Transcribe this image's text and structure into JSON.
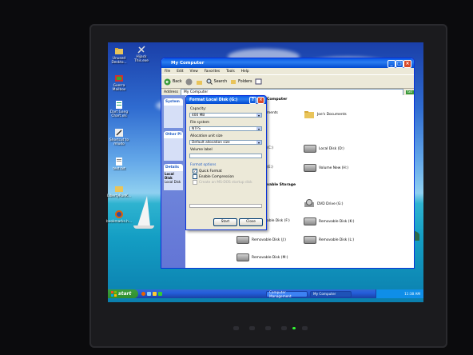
{
  "desktop": {
    "icons": [
      {
        "label": "Unused Deskto..."
      },
      {
        "label": "Hijack This.exe"
      },
      {
        "label": "Guerra Mailbox"
      },
      {
        "label": "Dart Gang Chart.xls"
      },
      {
        "label": "Shortcut to mludo"
      },
      {
        "label": "test.txt"
      },
      {
        "label": "LibertyRunK..."
      },
      {
        "label": "bookmarks.h..."
      }
    ]
  },
  "window": {
    "title": "My Computer",
    "menu": [
      "File",
      "Edit",
      "View",
      "Favorites",
      "Tools",
      "Help"
    ],
    "toolbar": {
      "back": "Back",
      "search": "Search",
      "folders": "Folders"
    },
    "address_label": "Address",
    "address_value": "My Computer",
    "go_label": "Go",
    "task_panels": [
      {
        "title": "System"
      },
      {
        "title": "Other Pl"
      },
      {
        "title": "Details"
      }
    ],
    "details": {
      "name": "Local Disk",
      "sub": "Local Disk"
    },
    "content": {
      "heading_files": "Computer",
      "heading_hdd": "",
      "heading_removable": "vable Storage",
      "shared_docs": "ments",
      "user_docs": "Joe's Documents",
      "drives": [
        {
          "label": "(C:)"
        },
        {
          "label": "Local Disk (D:)"
        },
        {
          "label": "(E:)"
        },
        {
          "label": "Volume New (H:)"
        }
      ],
      "removable": [
        {
          "label": "DVD Drive (G:)"
        },
        {
          "label": "able Disk (F:)"
        },
        {
          "label": "Removable Disk (K:)"
        },
        {
          "label": "Removable Disk (J:)"
        },
        {
          "label": "Removable Disk (L:)"
        },
        {
          "label": "Removable Disk (M:)"
        }
      ]
    }
  },
  "dialog": {
    "title": "Format Local Disk (G:)",
    "capacity_label": "Capacity:",
    "capacity_value": "400 MB",
    "fs_label": "File system",
    "fs_value": "NTFS",
    "alloc_label": "Allocation unit size",
    "alloc_value": "Default allocation size",
    "volume_label": "Volume label",
    "volume_value": "",
    "options_label": "Format options",
    "quick_format": "Quick Format",
    "quick_format_checked": true,
    "compression": "Enable Compression",
    "compression_checked": false,
    "msdos": "Create an MS-DOS startup disk",
    "start": "Start",
    "close": "Close"
  },
  "taskbar": {
    "start": "start",
    "tasks": [
      "Computer Management",
      "My Computer"
    ],
    "clock": "11:38 AM"
  },
  "colors": {
    "xp_blue": "#0a5ae8",
    "start_green": "#3c9e3c",
    "dialog_bg": "#ece9d8"
  }
}
